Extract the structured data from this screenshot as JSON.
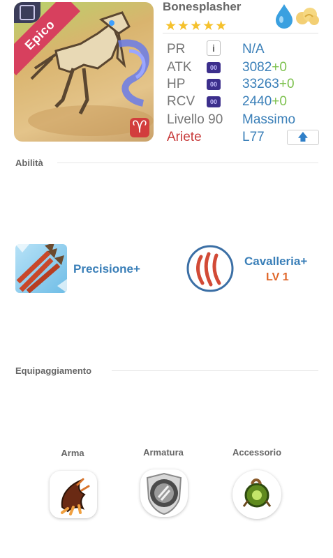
{
  "card": {
    "name": "Bonesplasher",
    "rarity": "Epico",
    "stars": "★★★★★",
    "sign_symbol": "♈"
  },
  "stats": {
    "pr": {
      "label": "PR",
      "chip": "i",
      "value": "N/A"
    },
    "atk": {
      "label": "ATK",
      "chip": "00",
      "value": "3082",
      "bonus": "+0"
    },
    "hp": {
      "label": "HP",
      "chip": "00",
      "value": "33263",
      "bonus": "+0"
    },
    "rcv": {
      "label": "RCV",
      "chip": "00",
      "value": "2440",
      "bonus": "+0"
    },
    "level": {
      "label": "Livello 90",
      "value": "Massimo"
    },
    "sign": {
      "label": "Ariete",
      "value": "L77",
      "button": "🡅"
    }
  },
  "sections": {
    "abilities": "Abilità",
    "equipment": "Equipaggiamento"
  },
  "abilities": {
    "active": {
      "name": "Precisione+"
    },
    "leader": {
      "name": "Cavalleria+",
      "level": "LV 1"
    }
  },
  "equipment": {
    "weapon": "Arma",
    "armor": "Armatura",
    "accessory": "Accessorio"
  },
  "colors": {
    "accent_blue": "#3a7fb8",
    "bonus_green": "#7dc14e",
    "sign_red": "#c83c3c",
    "rarity_pink": "#d7405e",
    "level_orange": "#e0672a",
    "stars_gold": "#f5c12c"
  },
  "icons": {
    "element_water": "water-drop-icon",
    "element_light": "cloud-icon"
  }
}
